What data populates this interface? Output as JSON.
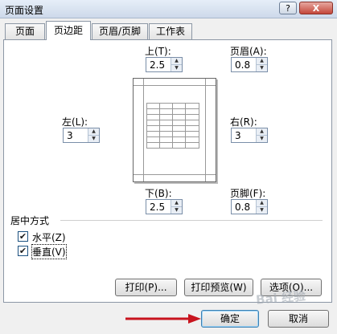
{
  "window": {
    "title": "页面设置",
    "help_label": "?",
    "close_label": "X"
  },
  "tabs": [
    {
      "label": "页面",
      "active": false
    },
    {
      "label": "页边距",
      "active": true
    },
    {
      "label": "页眉/页脚",
      "active": false
    },
    {
      "label": "工作表",
      "active": false
    }
  ],
  "margins": {
    "top": {
      "label": "上(T):",
      "value": "2.5"
    },
    "header": {
      "label": "页眉(A):",
      "value": "0.8"
    },
    "left": {
      "label": "左(L):",
      "value": "3"
    },
    "right": {
      "label": "右(R):",
      "value": "3"
    },
    "bottom": {
      "label": "下(B):",
      "value": "2.5"
    },
    "footer": {
      "label": "页脚(F):",
      "value": "0.8"
    }
  },
  "centering": {
    "title": "居中方式",
    "horizontal": {
      "label": "水平(Z)",
      "checked": true
    },
    "vertical": {
      "label": "垂直(V)",
      "checked": true
    }
  },
  "buttons": {
    "print": "打印(P)...",
    "print_preview": "打印预览(W)",
    "options": "选项(O)...",
    "ok": "确定",
    "cancel": "取消"
  },
  "colors": {
    "annotation_arrow": "#c8141e"
  },
  "watermark": "Bai 经验"
}
